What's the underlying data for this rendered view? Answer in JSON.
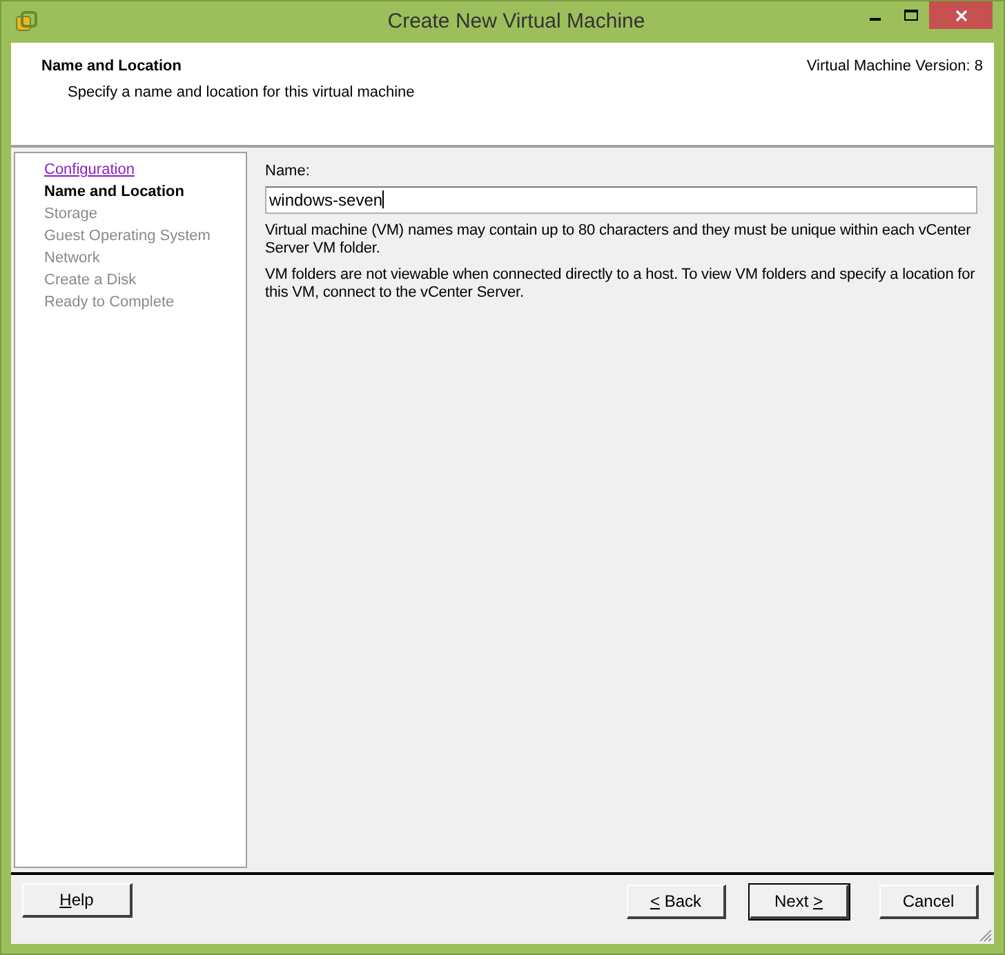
{
  "window": {
    "title": "Create New Virtual Machine"
  },
  "header": {
    "title": "Name and Location",
    "subtitle": "Specify a name and location for this virtual machine",
    "version": "Virtual Machine Version: 8"
  },
  "steps": [
    {
      "label": "Configuration",
      "kind": "link",
      "selected": false
    },
    {
      "label": "Name and Location",
      "kind": "current",
      "selected": true
    },
    {
      "label": "Storage",
      "kind": "pending",
      "selected": false
    },
    {
      "label": "Guest Operating System",
      "kind": "pending",
      "selected": false
    },
    {
      "label": "Network",
      "kind": "pending",
      "selected": false
    },
    {
      "label": "Create a Disk",
      "kind": "pending",
      "selected": false
    },
    {
      "label": "Ready to Complete",
      "kind": "pending",
      "selected": false
    }
  ],
  "form": {
    "label": "Name:",
    "value": "windows-seven",
    "notes": [
      "Virtual machine (VM) names may contain up to 80 characters and they must be unique within each vCenter Server VM folder.",
      "VM folders are not viewable when connected directly to a host. To view VM folders and specify a location for this VM, connect to the vCenter Server."
    ]
  },
  "buttons": [
    {
      "key": "H",
      "after": "elp",
      "default": false
    },
    {
      "key": "<",
      "after": " Back",
      "default": false
    },
    {
      "before": "Next ",
      "key": ">",
      "default": true
    },
    {
      "before": "Cancel",
      "default": false
    }
  ]
}
